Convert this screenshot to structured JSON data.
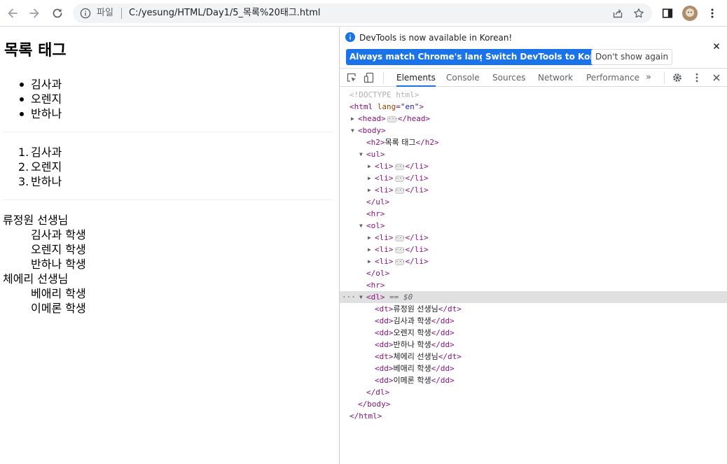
{
  "toolbar": {
    "back_icon": "arrow-left-icon",
    "forward_icon": "arrow-right-icon",
    "reload_icon": "reload-icon",
    "omnibox": {
      "scheme_label": "파일",
      "url": "C:/yesung/HTML/Day1/5_목록%20태그.html"
    },
    "share_icon": "share-icon",
    "star_icon": "bookmark-star-icon",
    "sidepanel_icon": "side-panel-icon",
    "profile_icon": "profile-avatar",
    "menu_icon": "kebab-menu-icon"
  },
  "page": {
    "heading": "목록 태그",
    "unordered_list": [
      "김사과",
      "오렌지",
      "반하나"
    ],
    "ordered_list": [
      {
        "num": "1.",
        "text": "김사과"
      },
      {
        "num": "2.",
        "text": "오렌지"
      },
      {
        "num": "3.",
        "text": "반하나"
      }
    ],
    "definition_list": [
      {
        "type": "dt",
        "text": "류정원 선생님"
      },
      {
        "type": "dd",
        "text": "김사과 학생"
      },
      {
        "type": "dd",
        "text": "오렌지 학생"
      },
      {
        "type": "dd",
        "text": "반하나 학생"
      },
      {
        "type": "dt",
        "text": "체에리 선생님"
      },
      {
        "type": "dd",
        "text": "베애리 학생"
      },
      {
        "type": "dd",
        "text": "이메론 학생"
      }
    ]
  },
  "devtools": {
    "notice": {
      "text": "DevTools is now available in Korean!",
      "btn_match": "Always match Chrome's language",
      "btn_switch": "Switch DevTools to Korean",
      "btn_dont_show": "Don't show again"
    },
    "tabs": [
      "Elements",
      "Console",
      "Sources",
      "Network",
      "Performance"
    ],
    "active_tab": "Elements",
    "more_tabs": "»",
    "dom": {
      "doctype": "<!DOCTYPE html>",
      "html_open": "<html",
      "lang_attr": "lang",
      "lang_value": "\"en\"",
      "head": "head",
      "body": "body",
      "h2_text": "목록 태그",
      "selected_marker": "== $0",
      "dl_items": [
        {
          "tag": "dt",
          "text": "류정원 선생님"
        },
        {
          "tag": "dd",
          "text": "김사과 학생"
        },
        {
          "tag": "dd",
          "text": "오렌지 학생"
        },
        {
          "tag": "dd",
          "text": "반하나 학생"
        },
        {
          "tag": "dt",
          "text": "체에리 선생님"
        },
        {
          "tag": "dd",
          "text": "베애리 학생"
        },
        {
          "tag": "dd",
          "text": "이메론 학생"
        }
      ]
    }
  },
  "colors": {
    "accent_blue": "#1a73e8",
    "tag_purple": "#881280",
    "attr_brown": "#994500",
    "value_blue": "#1a1aa6",
    "selected_row": "#e0e0e0"
  }
}
